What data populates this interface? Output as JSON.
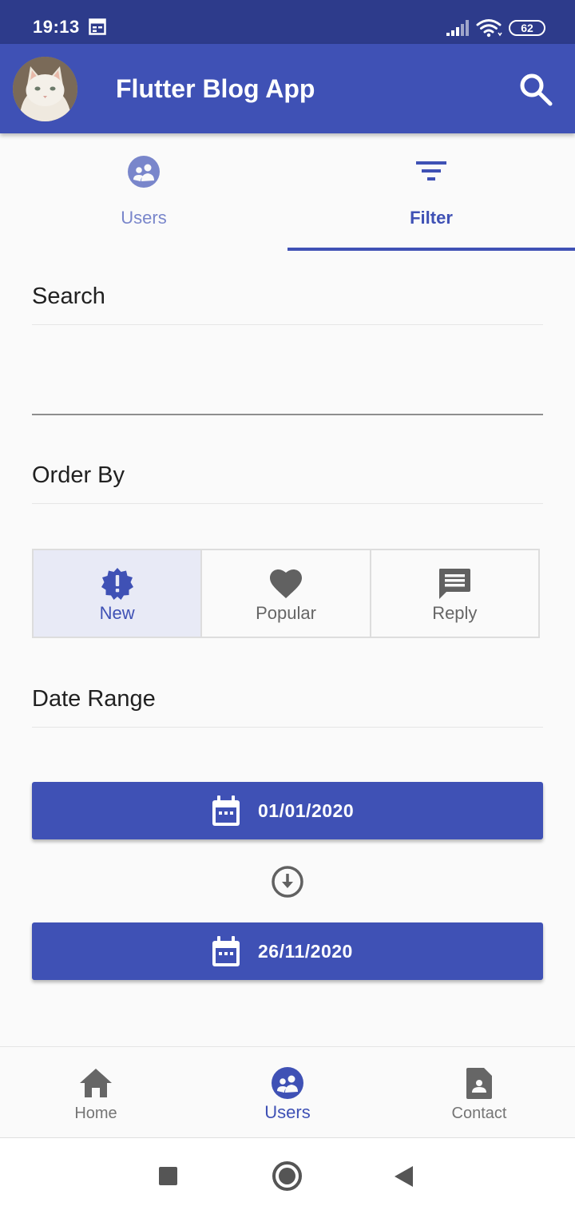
{
  "status_bar": {
    "time": "19:13",
    "battery": "62"
  },
  "app_bar": {
    "title": "Flutter Blog App"
  },
  "tabs": [
    {
      "label": "Users",
      "icon": "users-icon"
    },
    {
      "label": "Filter",
      "icon": "filter-icon",
      "selected": true
    }
  ],
  "filter": {
    "search_title": "Search",
    "search_value": "",
    "order_title": "Order By",
    "order_options": [
      {
        "label": "New",
        "icon": "new-badge-icon",
        "selected": true
      },
      {
        "label": "Popular",
        "icon": "heart-icon"
      },
      {
        "label": "Reply",
        "icon": "comment-icon"
      }
    ],
    "date_title": "Date Range",
    "date_from": "01/01/2020",
    "date_to": "26/11/2020"
  },
  "bottom_nav": [
    {
      "label": "Home",
      "icon": "home-icon"
    },
    {
      "label": "Users",
      "icon": "users-icon",
      "selected": true
    },
    {
      "label": "Contact",
      "icon": "contact-icon"
    }
  ],
  "colors": {
    "primary": "#3f51b5",
    "primary_dark": "#2d3b8b",
    "tab_unselected": "#7986cb",
    "selected_toggle_bg": "#e8eaf6"
  }
}
